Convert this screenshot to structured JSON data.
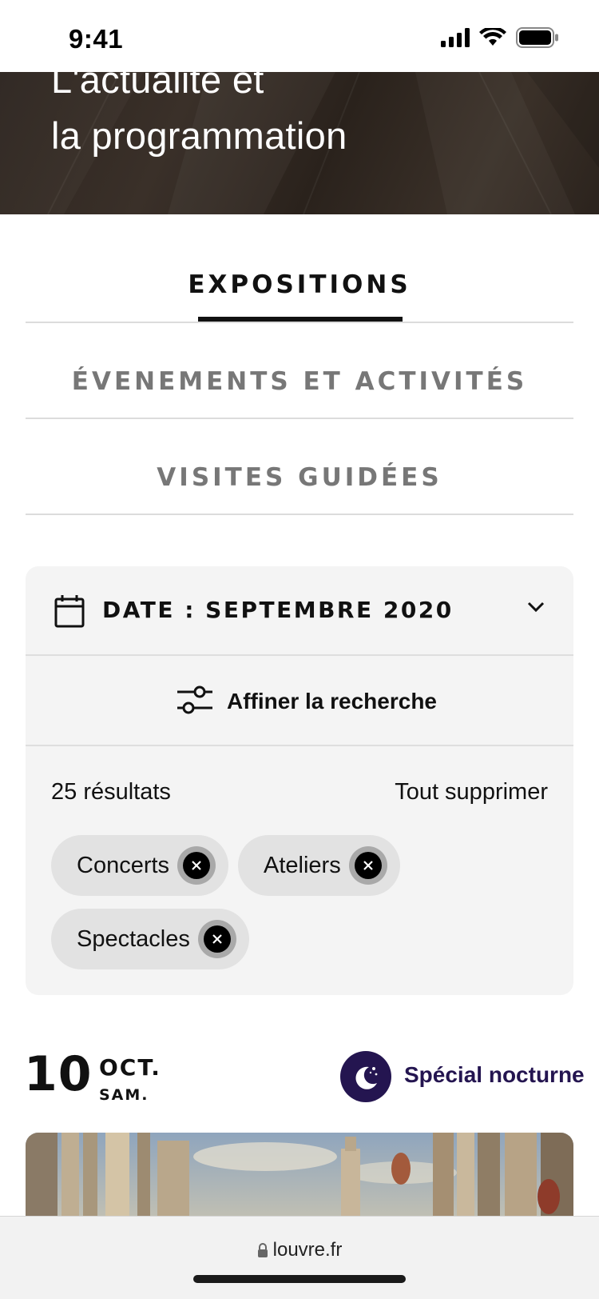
{
  "status_bar": {
    "time": "9:41"
  },
  "hero": {
    "line1": "L'actualité et",
    "line2": "la programmation"
  },
  "tabs": [
    {
      "label": "EXPOSITIONS",
      "active": true
    },
    {
      "label": "ÉVENEMENTS ET ACTIVITÉS",
      "active": false
    },
    {
      "label": "VISITES GUIDÉES",
      "active": false
    }
  ],
  "filters": {
    "date_label": "DATE : SEPTEMBRE 2020",
    "refine_label": "Affiner la recherche",
    "results_count": "25 résultats",
    "clear_all": "Tout supprimer",
    "chips": [
      {
        "label": "Concerts"
      },
      {
        "label": "Ateliers"
      },
      {
        "label": "Spectacles"
      }
    ]
  },
  "event": {
    "day": "10",
    "month": "OCT.",
    "weekday": "SAM.",
    "badge_label": "Spécial nocturne"
  },
  "browser": {
    "url": "louvre.fr"
  },
  "colors": {
    "accent_nocturne": "#241550",
    "panel_bg": "#f4f4f4",
    "chip_bg": "#e2e2e2"
  }
}
